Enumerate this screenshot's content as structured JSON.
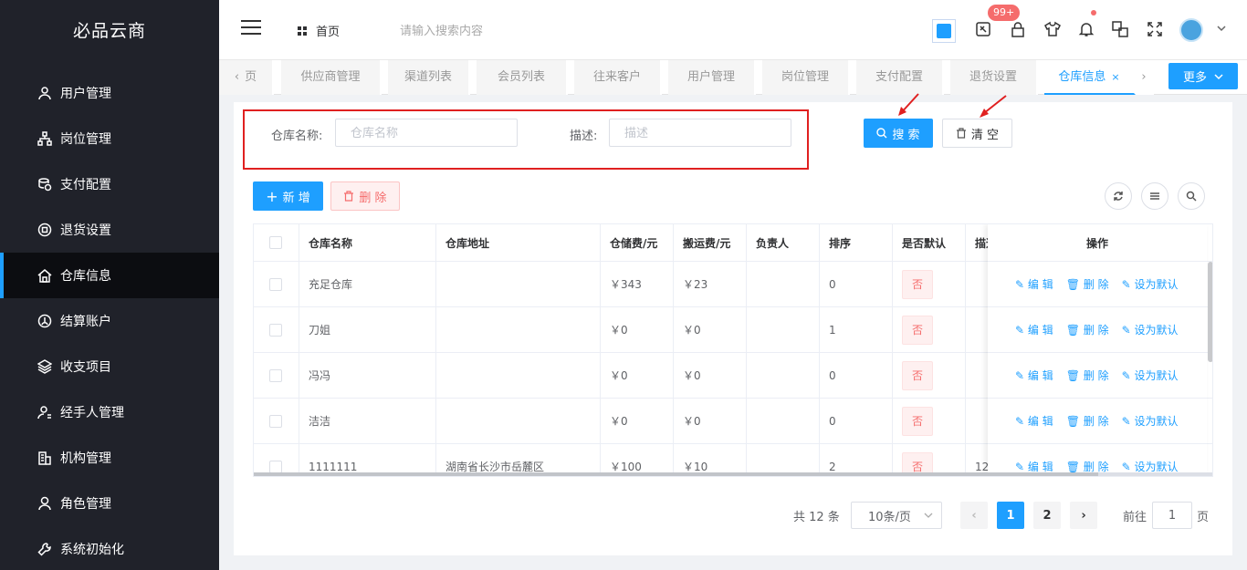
{
  "brand": "必品云商",
  "menu": [
    {
      "label": "用户管理",
      "icon": "user-icon"
    },
    {
      "label": "岗位管理",
      "icon": "org-tree-icon"
    },
    {
      "label": "支付配置",
      "icon": "coins-icon"
    },
    {
      "label": "退货设置",
      "icon": "return-icon"
    },
    {
      "label": "仓库信息",
      "icon": "home-icon",
      "active": true
    },
    {
      "label": "结算账户",
      "icon": "account-icon"
    },
    {
      "label": "收支项目",
      "icon": "layers-icon"
    },
    {
      "label": "经手人管理",
      "icon": "handler-icon"
    },
    {
      "label": "机构管理",
      "icon": "building-icon"
    },
    {
      "label": "角色管理",
      "icon": "role-icon"
    },
    {
      "label": "系统初始化",
      "icon": "wrench-icon"
    }
  ],
  "header": {
    "home": "首页",
    "search_placeholder": "请输入搜索内容",
    "badge": "99+"
  },
  "tabs": [
    "页",
    "供应商管理",
    "渠道列表",
    "会员列表",
    "往来客户",
    "用户管理",
    "岗位管理",
    "支付配置",
    "退货设置",
    "仓库信息"
  ],
  "more_label": "更多",
  "form": {
    "name_label": "仓库名称:",
    "name_placeholder": "仓库名称",
    "desc_label": "描述:",
    "desc_placeholder": "描述",
    "search_label": "搜 索",
    "clear_label": "清 空"
  },
  "actions": {
    "add_label": "新 增",
    "delete_label": "删 除"
  },
  "table": {
    "headers": [
      "仓库名称",
      "仓库地址",
      "仓储费/元",
      "搬运费/元",
      "负责人",
      "排序",
      "是否默认",
      "描述"
    ],
    "op_header": "操作",
    "rows": [
      {
        "name": "充足仓库",
        "address": "",
        "storage": "￥343",
        "carry": "￥23",
        "owner": "",
        "sort": "0",
        "default": "否",
        "desc": ""
      },
      {
        "name": "刀姐",
        "address": "",
        "storage": "￥0",
        "carry": "￥0",
        "owner": "",
        "sort": "1",
        "default": "否",
        "desc": ""
      },
      {
        "name": "冯冯",
        "address": "",
        "storage": "￥0",
        "carry": "￥0",
        "owner": "",
        "sort": "0",
        "default": "否",
        "desc": ""
      },
      {
        "name": "洁洁",
        "address": "",
        "storage": "￥0",
        "carry": "￥0",
        "owner": "",
        "sort": "0",
        "default": "否",
        "desc": ""
      },
      {
        "name": "1111111",
        "address": "湖南省长沙市岳麓区",
        "storage": "￥100",
        "carry": "￥10",
        "owner": "",
        "sort": "2",
        "default": "否",
        "desc": "12"
      }
    ],
    "op_labels": {
      "edit": "编 辑",
      "delete": "删 除",
      "set_default": "设为默认"
    }
  },
  "pagination": {
    "total": "共 12 条",
    "page_size": "10条/页",
    "pages": [
      "1",
      "2"
    ],
    "current": "1",
    "goto_label": "前往",
    "goto_value": "1",
    "page_suffix": "页"
  }
}
